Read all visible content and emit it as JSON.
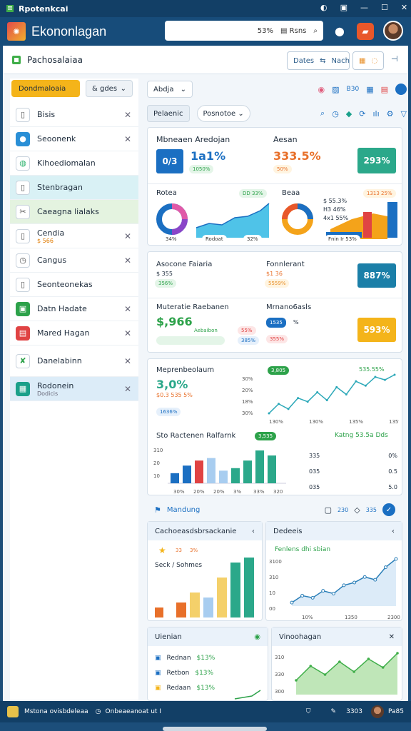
{
  "titlebar": {
    "title": "Rpotenkcai"
  },
  "appbar": {
    "name": "Ekononlagan",
    "search_text": "53%",
    "search_btn": "Rsns"
  },
  "header": {
    "title": "Pachosalaiaa",
    "btn1": "Dates",
    "btn2": "Nach"
  },
  "sidebar": {
    "primary_btn": "Dondmaloaia",
    "select": "& gdes",
    "items": [
      {
        "label": "Bisis",
        "icon": "document-icon",
        "color": "#ffffff",
        "fg": "#555"
      },
      {
        "label": "Seoonenk",
        "icon": "person-icon",
        "color": "#2a8fd6",
        "fg": "#fff"
      },
      {
        "label": "Kihoediomalan",
        "icon": "chat-icon",
        "color": "#ffffff",
        "fg": "#2bb26b"
      },
      {
        "label": "Stenbragan",
        "icon": "document-icon",
        "color": "#ffffff",
        "fg": "#555"
      },
      {
        "label": "Caeagna lialaks",
        "icon": "tools-icon",
        "color": "#ffffff",
        "fg": "#555"
      },
      {
        "label": "Cendia",
        "sub": "$ 566",
        "icon": "document-icon",
        "color": "#ffffff",
        "fg": "#555"
      },
      {
        "label": "Cangus",
        "icon": "clock-icon",
        "color": "#ffffff",
        "fg": "#555"
      },
      {
        "label": "Seonteonekas",
        "icon": "document-icon",
        "color": "#ffffff",
        "fg": "#555"
      },
      {
        "label": "Datn Hadate",
        "icon": "calendar-icon",
        "color": "#2da24a",
        "fg": "#fff"
      },
      {
        "label": "Mared Hagan",
        "icon": "list-icon",
        "color": "#e04343",
        "fg": "#fff"
      },
      {
        "label": "Danelabinn",
        "icon": "x-logo-icon",
        "color": "#ffffff",
        "fg": "#2da24a"
      },
      {
        "label": "Rodonein",
        "sub": "Dodicis",
        "icon": "table-icon",
        "color": "#1aa08a",
        "fg": "#fff"
      }
    ]
  },
  "toolbar": {
    "select": "Abdja",
    "seg1": "Pelaenic",
    "seg2": "Posnotoe",
    "label": "B30"
  },
  "kpi1": {
    "title": "Mbneaen Aredojan",
    "tile": "0/3",
    "value": "1a1%",
    "tag": "1050%",
    "right_title": "Aesan",
    "right_value": "333.5%",
    "right_sub": "50%",
    "tile2": "293%"
  },
  "mini": {
    "left_title": "Rotea",
    "left_tag": "DD 33%",
    "left_pct1": "34%",
    "left_pct2": "Rodoat",
    "left_pct3": "32%",
    "right_title": "Beaa",
    "right_tag": "1313 25%",
    "right_sub1": "$ 55.3%",
    "right_sub2": "H3 46%",
    "right_sub3": "4x1 55%",
    "right_sub4": "Fnin Ir 53%"
  },
  "kpi2": {
    "title": "Asocone Faiaria",
    "sub": "$ 355",
    "tag": "356%",
    "right_title": "Fonnlerant",
    "right_sub": "$1 36",
    "right_tag": "5559%",
    "tile": "887%",
    "b_title": "Muteratie Raebanen",
    "b_value": "$,966",
    "b_tag1": "Aebaibon",
    "b_tag2": "55%",
    "b_tag3": "385%",
    "b_right_title": "Mrnano6asls",
    "b_right_tag": "1535",
    "b_right_pct": "%",
    "b_right_sub": "355%",
    "b_tile": "593%"
  },
  "line1": {
    "title": "Meprenbeolaum",
    "value": "3,0%",
    "sub": "$0.3 535 5%",
    "tag": "1636%",
    "percent_label": "535.55%",
    "badge": "3,805",
    "y_ticks": [
      "30%",
      "20%",
      "18%",
      "30%"
    ],
    "x_ticks": [
      "130%",
      "130%",
      "135%",
      "135%"
    ],
    "values": [
      42,
      55,
      48,
      63,
      58,
      71,
      60,
      78,
      68,
      86,
      80,
      92,
      88,
      95
    ]
  },
  "bar1": {
    "title": "Sto Ractenen Ralfarnk",
    "badge": "3,535",
    "right_title": "Katng 53.5a Dds",
    "y_ticks": [
      "310",
      "20",
      "10"
    ],
    "x_ticks": [
      "30%",
      "20%",
      "20%",
      "3%",
      "33%",
      "320"
    ],
    "values": [
      4,
      7,
      9,
      10,
      5,
      6,
      9,
      13,
      11
    ],
    "colors": [
      "#1b6fc2",
      "#1b6fc2",
      "#e04343",
      "#a8cdf0",
      "#a8cdf0",
      "#2ba88a",
      "#2ba88a",
      "#2ba88a",
      "#2ba88a"
    ],
    "r_labels": [
      "335",
      "035",
      "035"
    ],
    "r_right": [
      "0%",
      "0.5",
      "5.0"
    ]
  },
  "section": {
    "title": "Mandung",
    "a": "230",
    "b": "335"
  },
  "chartA": {
    "title": "Cachoeasdsbrsackanie",
    "tag1": "33",
    "tag2": "3%",
    "label": "Seck / Sohmes",
    "values": [
      3,
      5,
      4,
      8,
      11,
      12
    ]
  },
  "chartB": {
    "title": "Dedeeis",
    "subtitle": "Fenlens dhi sbian",
    "y_ticks": [
      "3100",
      "310",
      "10",
      "00"
    ],
    "x_ticks": [
      "10%",
      "1350",
      "2300"
    ],
    "values": [
      5,
      15,
      12,
      22,
      18,
      30,
      34,
      42,
      38,
      56,
      68
    ]
  },
  "listC": {
    "title": "Uienian",
    "rows": [
      {
        "label": "Rednan",
        "value": "$13%"
      },
      {
        "label": "Retbon",
        "value": "$13%"
      },
      {
        "label": "Redaan",
        "value": "$13%"
      }
    ]
  },
  "chartD": {
    "title": "Vinoohagan",
    "y_ticks": [
      "310",
      "330",
      "300"
    ],
    "values": [
      20,
      40,
      28,
      46,
      32,
      50,
      38,
      58
    ]
  },
  "statusbar": {
    "left": "Mstona ovisbdeleaa",
    "mid": "Onbeaeanoat ut I",
    "right1": "3303",
    "right2": "Pa85"
  }
}
